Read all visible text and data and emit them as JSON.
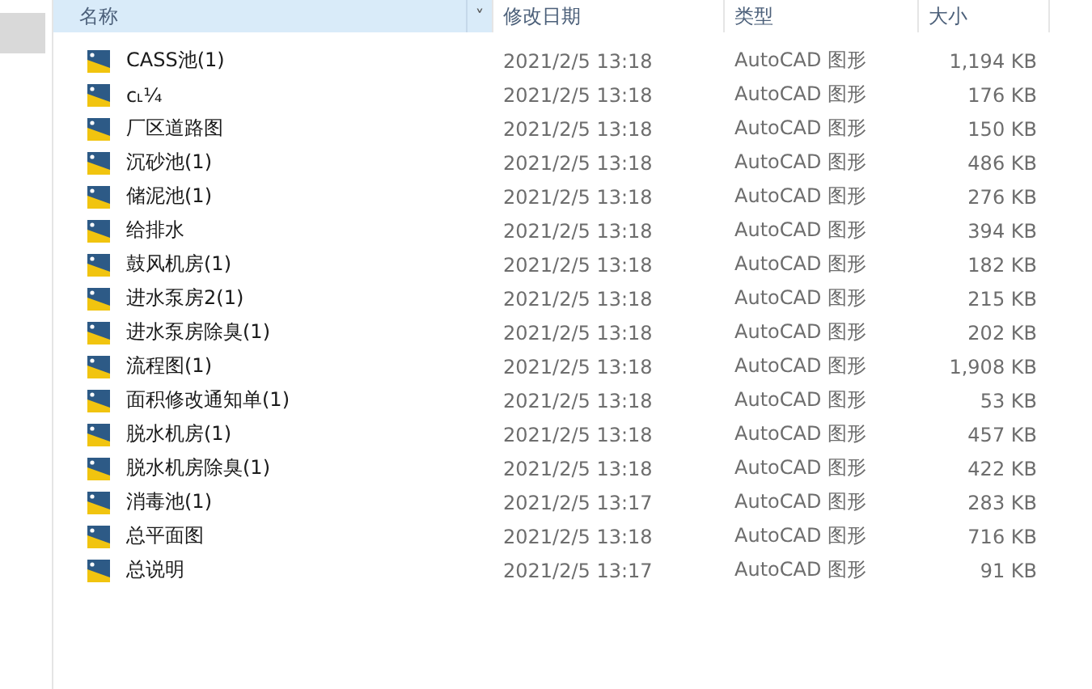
{
  "columns": [
    {
      "label": "名称",
      "selected": true,
      "sort_caret": "˅"
    },
    {
      "label": "修改日期",
      "selected": false
    },
    {
      "label": "类型",
      "selected": false
    },
    {
      "label": "大小",
      "selected": false
    }
  ],
  "files": [
    {
      "name": "CASS池(1)",
      "modified": "2021/2/5 13:18",
      "type": "AutoCAD 图形",
      "size": "1,194 KB"
    },
    {
      "name": "c˪¼",
      "modified": "2021/2/5 13:18",
      "type": "AutoCAD 图形",
      "size": "176 KB"
    },
    {
      "name": "厂区道路图",
      "modified": "2021/2/5 13:18",
      "type": "AutoCAD 图形",
      "size": "150 KB"
    },
    {
      "name": "沉砂池(1)",
      "modified": "2021/2/5 13:18",
      "type": "AutoCAD 图形",
      "size": "486 KB"
    },
    {
      "name": "储泥池(1)",
      "modified": "2021/2/5 13:18",
      "type": "AutoCAD 图形",
      "size": "276 KB"
    },
    {
      "name": "给排水",
      "modified": "2021/2/5 13:18",
      "type": "AutoCAD 图形",
      "size": "394 KB"
    },
    {
      "name": "鼓风机房(1)",
      "modified": "2021/2/5 13:18",
      "type": "AutoCAD 图形",
      "size": "182 KB"
    },
    {
      "name": "进水泵房2(1)",
      "modified": "2021/2/5 13:18",
      "type": "AutoCAD 图形",
      "size": "215 KB"
    },
    {
      "name": "进水泵房除臭(1)",
      "modified": "2021/2/5 13:18",
      "type": "AutoCAD 图形",
      "size": "202 KB"
    },
    {
      "name": "流程图(1)",
      "modified": "2021/2/5 13:18",
      "type": "AutoCAD 图形",
      "size": "1,908 KB"
    },
    {
      "name": "面积修改通知单(1)",
      "modified": "2021/2/5 13:18",
      "type": "AutoCAD 图形",
      "size": "53 KB"
    },
    {
      "name": "脱水机房(1)",
      "modified": "2021/2/5 13:18",
      "type": "AutoCAD 图形",
      "size": "457 KB"
    },
    {
      "name": "脱水机房除臭(1)",
      "modified": "2021/2/5 13:18",
      "type": "AutoCAD 图形",
      "size": "422 KB"
    },
    {
      "name": "消毒池(1)",
      "modified": "2021/2/5 13:17",
      "type": "AutoCAD 图形",
      "size": "283 KB"
    },
    {
      "name": "总平面图",
      "modified": "2021/2/5 13:18",
      "type": "AutoCAD 图形",
      "size": "716 KB"
    },
    {
      "name": "总说明",
      "modified": "2021/2/5 13:17",
      "type": "AutoCAD 图形",
      "size": "91 KB"
    }
  ]
}
